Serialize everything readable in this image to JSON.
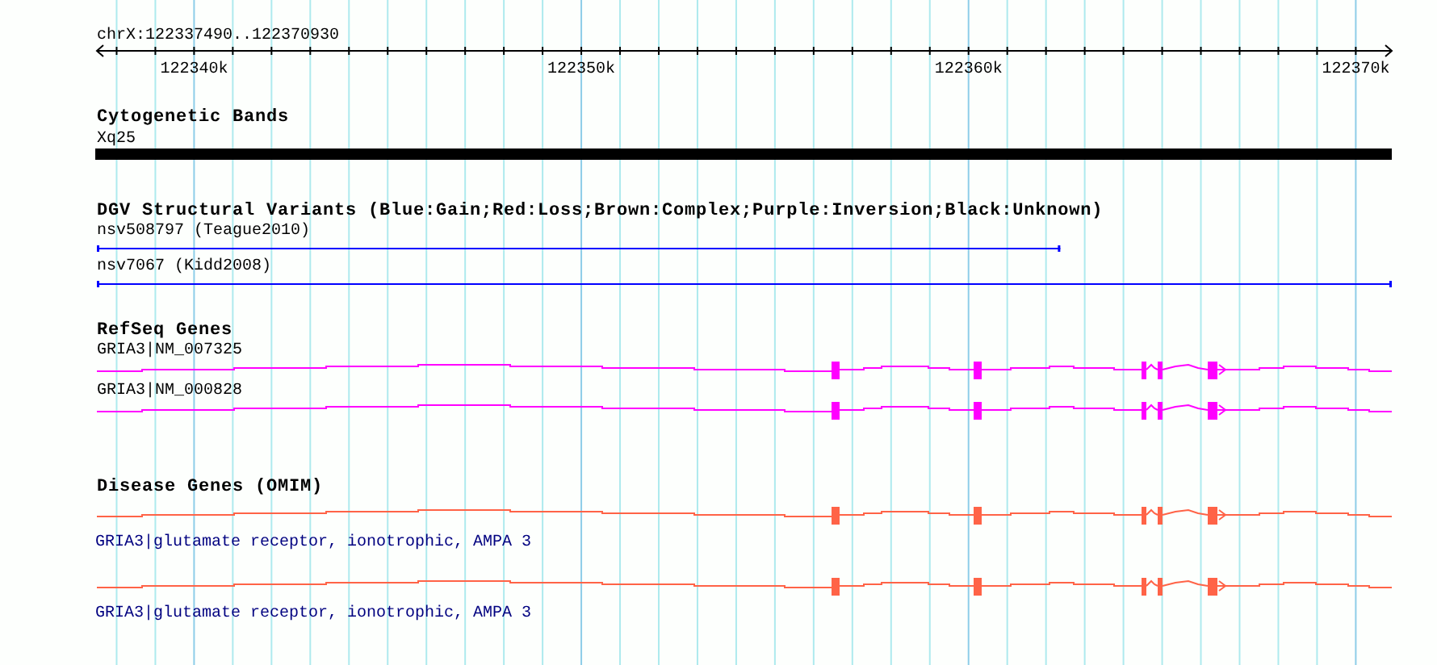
{
  "ruler": {
    "position": "chrX:122337490..122370930",
    "tick_labels": [
      "122340k",
      "122350k",
      "122360k",
      "122370k"
    ]
  },
  "tracks": [
    {
      "kind": "band",
      "title": "Cytogenetic Bands",
      "features": [
        {
          "label": "Xq25"
        }
      ]
    },
    {
      "kind": "variant",
      "title": "DGV Structural Variants (Blue:Gain;Red:Loss;Brown:Complex;Purple:Inversion;Black:Unknown)",
      "features": [
        {
          "label": "nsv508797 (Teague2010)",
          "color": "#0000ff",
          "level": 0.744
        },
        {
          "label": "nsv7067 (Kidd2008)",
          "color": "#0000ff",
          "level": 1
        }
      ]
    },
    {
      "kind": "gene",
      "title": "RefSeq Genes",
      "features": [
        {
          "label": "GRIA3|NM_007325",
          "color": "#ff00ff"
        },
        {
          "label": "GRIA3|NM_000828",
          "color": "#ff00ff"
        }
      ]
    },
    {
      "kind": "disease_gene",
      "title": "Disease Genes (OMIM)",
      "features": [
        {
          "label": "GRIA3|glutamate receptor, ionotrophic, AMPA 3",
          "color": "#ff6347"
        },
        {
          "label": "GRIA3|glutamate receptor, ionotrophic, AMPA 3",
          "color": "#ff6347"
        }
      ]
    }
  ]
}
